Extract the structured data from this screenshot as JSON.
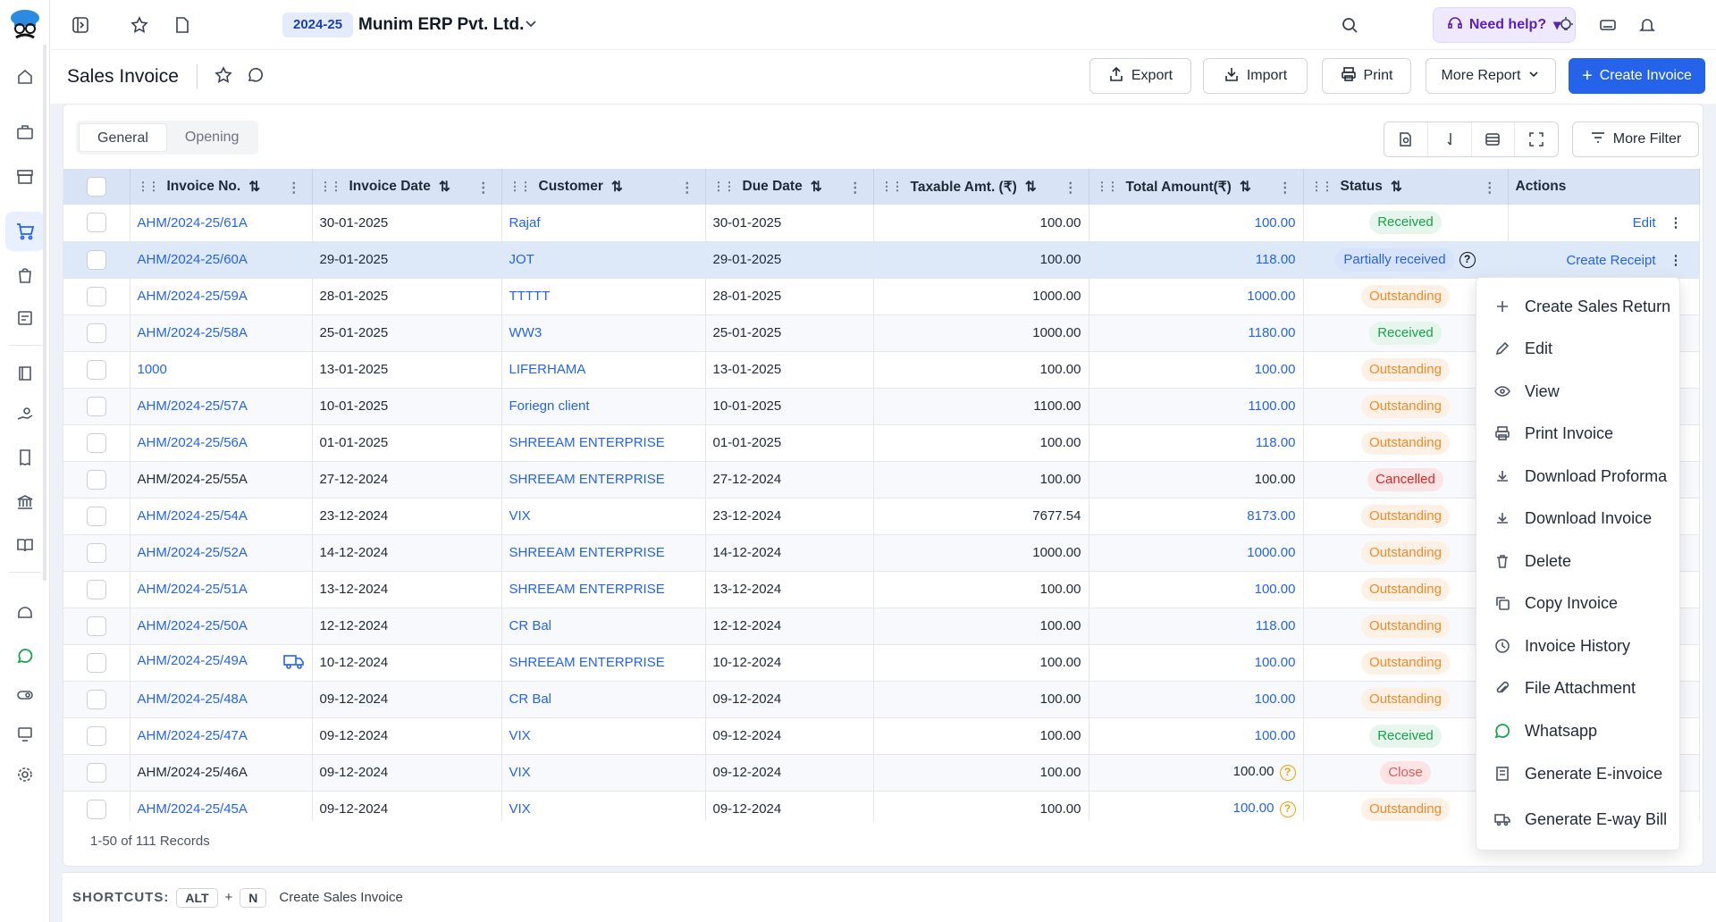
{
  "topbar": {
    "year": "2024-25",
    "company": "Munim ERP Pvt. Ltd.",
    "need_help": "Need help?"
  },
  "page": {
    "title": "Sales Invoice",
    "buttons": {
      "export": "Export",
      "import": "Import",
      "print": "Print",
      "more_report": "More Report",
      "create_invoice": "Create Invoice"
    }
  },
  "tabs": [
    "General",
    "Opening"
  ],
  "more_filter": "More Filter",
  "columns": [
    "Invoice No.",
    "Invoice Date",
    "Customer",
    "Due Date",
    "Taxable Amt. (₹)",
    "Total Amount(₹)",
    "Status",
    "Actions"
  ],
  "rows": [
    {
      "inv": "AHM/2024-25/61A",
      "date": "30-01-2025",
      "cust": "Rajaf",
      "due": "30-01-2025",
      "tax": "100.00",
      "total": "100.00",
      "status": "Received",
      "action": "Edit"
    },
    {
      "inv": "AHM/2024-25/60A",
      "date": "29-01-2025",
      "cust": "JOT",
      "due": "29-01-2025",
      "tax": "100.00",
      "total": "118.00",
      "status": "Partially received",
      "action": "Create Receipt"
    },
    {
      "inv": "AHM/2024-25/59A",
      "date": "28-01-2025",
      "cust": "TTTTT",
      "due": "28-01-2025",
      "tax": "1000.00",
      "total": "1000.00",
      "status": "Outstanding",
      "action": ""
    },
    {
      "inv": "AHM/2024-25/58A",
      "date": "25-01-2025",
      "cust": "WW3",
      "due": "25-01-2025",
      "tax": "1000.00",
      "total": "1180.00",
      "status": "Received",
      "action": ""
    },
    {
      "inv": "1000",
      "date": "13-01-2025",
      "cust": "LIFERHAMA",
      "due": "13-01-2025",
      "tax": "100.00",
      "total": "100.00",
      "status": "Outstanding",
      "action": ""
    },
    {
      "inv": "AHM/2024-25/57A",
      "date": "10-01-2025",
      "cust": "Foriegn client",
      "due": "10-01-2025",
      "tax": "1100.00",
      "total": "1100.00",
      "status": "Outstanding",
      "action": ""
    },
    {
      "inv": "AHM/2024-25/56A",
      "date": "01-01-2025",
      "cust": "SHREEAM ENTERPRISE",
      "due": "01-01-2025",
      "tax": "100.00",
      "total": "118.00",
      "status": "Outstanding",
      "action": ""
    },
    {
      "inv": "AHM/2024-25/55A",
      "date": "27-12-2024",
      "cust": "SHREEAM ENTERPRISE",
      "due": "27-12-2024",
      "tax": "100.00",
      "total": "100.00",
      "status": "Cancelled",
      "action": ""
    },
    {
      "inv": "AHM/2024-25/54A",
      "date": "23-12-2024",
      "cust": "VIX",
      "due": "23-12-2024",
      "tax": "7677.54",
      "total": "8173.00",
      "status": "Outstanding",
      "action": ""
    },
    {
      "inv": "AHM/2024-25/52A",
      "date": "14-12-2024",
      "cust": "SHREEAM ENTERPRISE",
      "due": "14-12-2024",
      "tax": "1000.00",
      "total": "1000.00",
      "status": "Outstanding",
      "action": ""
    },
    {
      "inv": "AHM/2024-25/51A",
      "date": "13-12-2024",
      "cust": "SHREEAM ENTERPRISE",
      "due": "13-12-2024",
      "tax": "100.00",
      "total": "100.00",
      "status": "Outstanding",
      "action": ""
    },
    {
      "inv": "AHM/2024-25/50A",
      "date": "12-12-2024",
      "cust": "CR Bal",
      "due": "12-12-2024",
      "tax": "100.00",
      "total": "118.00",
      "status": "Outstanding",
      "action": ""
    },
    {
      "inv": "AHM/2024-25/49A",
      "date": "10-12-2024",
      "cust": "SHREEAM ENTERPRISE",
      "due": "10-12-2024",
      "tax": "100.00",
      "total": "100.00",
      "status": "Outstanding",
      "action": ""
    },
    {
      "inv": "AHM/2024-25/48A",
      "date": "09-12-2024",
      "cust": "CR Bal",
      "due": "09-12-2024",
      "tax": "100.00",
      "total": "100.00",
      "status": "Outstanding",
      "action": ""
    },
    {
      "inv": "AHM/2024-25/47A",
      "date": "09-12-2024",
      "cust": "VIX",
      "due": "09-12-2024",
      "tax": "100.00",
      "total": "100.00",
      "status": "Received",
      "action": ""
    },
    {
      "inv": "AHM/2024-25/46A",
      "date": "09-12-2024",
      "cust": "VIX",
      "due": "09-12-2024",
      "tax": "100.00",
      "total": "100.00",
      "status": "Close",
      "action": ""
    },
    {
      "inv": "AHM/2024-25/45A",
      "date": "09-12-2024",
      "cust": "VIX",
      "due": "09-12-2024",
      "tax": "100.00",
      "total": "100.00",
      "status": "Outstanding",
      "action": ""
    }
  ],
  "records": "1-50 of 111 Records",
  "shortcuts": {
    "label": "SHORTCUTS:",
    "key1": "ALT",
    "plus": "+",
    "key2": "N",
    "desc": "Create Sales Invoice"
  },
  "menu": [
    "Create Sales Return",
    "Edit",
    "View",
    "Print Invoice",
    "Download Proforma",
    "Download Invoice",
    "Delete",
    "Copy Invoice",
    "Invoice History",
    "File Attachment",
    "Whatsapp",
    "Generate E-invoice",
    "Generate E-way Bill"
  ],
  "colors": {
    "accent": "#2563eb",
    "received": "#16a34a",
    "outstanding": "#f08a2c",
    "cancelled": "#dc2626",
    "whatsapp": "#16a34a"
  }
}
